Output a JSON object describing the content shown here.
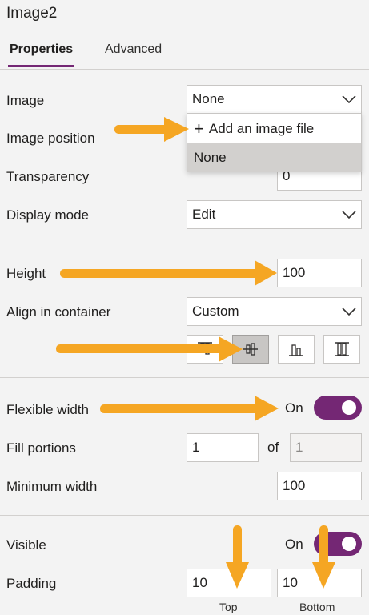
{
  "panel": {
    "title": "Image2"
  },
  "tabs": [
    {
      "label": "Properties"
    },
    {
      "label": "Advanced"
    }
  ],
  "rows": {
    "image": {
      "label": "Image",
      "value": "None"
    },
    "image_position": {
      "label": "Image position"
    },
    "transparency": {
      "label": "Transparency",
      "value": "0"
    },
    "display_mode": {
      "label": "Display mode",
      "value": "Edit"
    },
    "height": {
      "label": "Height",
      "value": "100"
    },
    "align": {
      "label": "Align in container",
      "value": "Custom"
    },
    "flexible_width": {
      "label": "Flexible width",
      "state": "On"
    },
    "fill_portions": {
      "label": "Fill portions",
      "value": "1",
      "of_label": "of",
      "total": "1"
    },
    "minimum_width": {
      "label": "Minimum width",
      "value": "100"
    },
    "visible": {
      "label": "Visible",
      "state": "On"
    },
    "padding": {
      "label": "Padding",
      "top_value": "10",
      "bottom_value": "10",
      "top_label": "Top",
      "bottom_label": "Bottom"
    }
  },
  "image_menu": {
    "items": [
      {
        "label": "Add an image file",
        "icon": "plus-icon"
      },
      {
        "label": "None"
      }
    ],
    "selected_index": 1
  },
  "align_buttons": [
    {
      "icon": "align-top-icon"
    },
    {
      "icon": "align-center-icon"
    },
    {
      "icon": "align-bottom-icon"
    },
    {
      "icon": "align-stretch-icon"
    }
  ],
  "align_selected_index": 1,
  "colors": {
    "accent": "#742774",
    "annotation_arrow": "#f5a623",
    "menu_selected": "#d2d0ce"
  }
}
